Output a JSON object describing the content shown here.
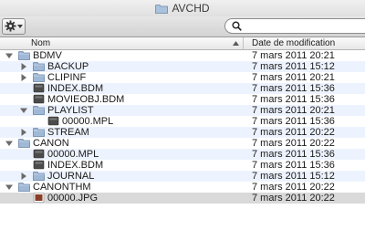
{
  "window": {
    "title": "AVCHD"
  },
  "toolbar": {
    "search_placeholder": ""
  },
  "columns": {
    "name": "Nom",
    "date": "Date de modification"
  },
  "rows": [
    {
      "name": "BDMV",
      "date": "7 mars 2011 20:21",
      "kind": "folder",
      "level": 0,
      "expanded": true
    },
    {
      "name": "BACKUP",
      "date": "7 mars 2011 15:12",
      "kind": "folder",
      "level": 1,
      "expanded": false
    },
    {
      "name": "CLIPINF",
      "date": "7 mars 2011 20:21",
      "kind": "folder",
      "level": 1,
      "expanded": false
    },
    {
      "name": "INDEX.BDM",
      "date": "7 mars 2011 15:36",
      "kind": "document",
      "level": 1
    },
    {
      "name": "MOVIEOBJ.BDM",
      "date": "7 mars 2011 15:36",
      "kind": "document",
      "level": 1
    },
    {
      "name": "PLAYLIST",
      "date": "7 mars 2011 20:21",
      "kind": "folder",
      "level": 1,
      "expanded": true
    },
    {
      "name": "00000.MPL",
      "date": "7 mars 2011 15:36",
      "kind": "document",
      "level": 2
    },
    {
      "name": "STREAM",
      "date": "7 mars 2011 20:22",
      "kind": "folder",
      "level": 1,
      "expanded": false
    },
    {
      "name": "CANON",
      "date": "7 mars 2011 20:22",
      "kind": "folder",
      "level": 0,
      "expanded": true
    },
    {
      "name": "00000.MPL",
      "date": "7 mars 2011 15:36",
      "kind": "document",
      "level": 1
    },
    {
      "name": "INDEX.BDM",
      "date": "7 mars 2011 15:36",
      "kind": "document",
      "level": 1
    },
    {
      "name": "JOURNAL",
      "date": "7 mars 2011 15:12",
      "kind": "folder",
      "level": 1,
      "expanded": false
    },
    {
      "name": "CANONTHM",
      "date": "7 mars 2011 20:22",
      "kind": "folder",
      "level": 0,
      "expanded": true
    },
    {
      "name": "00000.JPG",
      "date": "7 mars 2011 20:22",
      "kind": "image",
      "level": 1
    }
  ]
}
